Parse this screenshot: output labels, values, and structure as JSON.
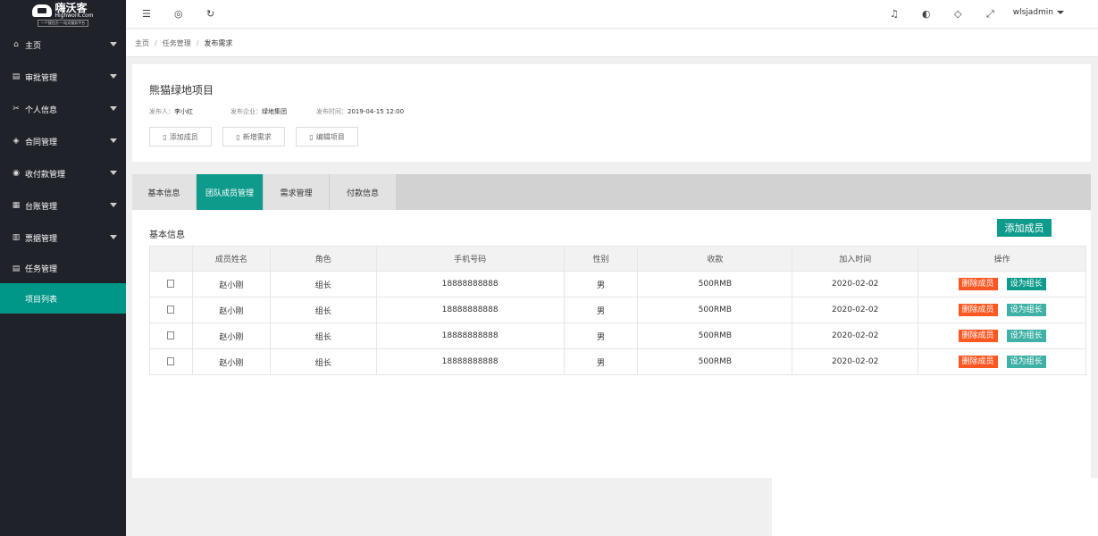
{
  "logo": {
    "name_cn": "嗨沃客",
    "name_en": "Highwork.com",
    "slogan": "一个接包方·一站式服务平台"
  },
  "sidebar": {
    "items": [
      {
        "label": "主页",
        "icon": "home-icon"
      },
      {
        "label": "审批管理",
        "icon": "approval-icon"
      },
      {
        "label": "个人信息",
        "icon": "user-info-icon"
      },
      {
        "label": "合同管理",
        "icon": "contract-icon"
      },
      {
        "label": "收付款管理",
        "icon": "payment-icon"
      },
      {
        "label": "台账管理",
        "icon": "ledger-icon"
      },
      {
        "label": "票据管理",
        "icon": "invoice-icon"
      },
      {
        "label": "任务管理",
        "icon": "task-icon"
      }
    ],
    "sub_item": "项目列表"
  },
  "header": {
    "user": "wlsjadmin"
  },
  "breadcrumb": {
    "home": "主页",
    "level1": "任务管理",
    "current": "发布需求"
  },
  "project": {
    "title": "熊猫绿地项目",
    "publisher_label": "发布人：",
    "publisher": "李小红",
    "company_label": "发布企业：",
    "company": "绿地集团",
    "time_label": "发布时间：",
    "time": "2019-04-15 12:00",
    "buttons": [
      "添加成员",
      "新增需求",
      "编辑项目"
    ]
  },
  "tabs": [
    "基本信息",
    "团队成员管理",
    "需求管理",
    "付款信息"
  ],
  "active_tab": "团队成员管理",
  "panel": {
    "title": "基本信息",
    "add_button": "添加成员",
    "columns": [
      "",
      "成员姓名",
      "角色",
      "手机号码",
      "性别",
      "收款",
      "加入时间",
      "操作"
    ],
    "rows": [
      {
        "name": "赵小刚",
        "role": "组长",
        "phone": "18888888888",
        "gender": "男",
        "amount": "500RMB",
        "joined": "2020-02-02"
      },
      {
        "name": "赵小刚",
        "role": "组长",
        "phone": "18888888888",
        "gender": "男",
        "amount": "500RMB",
        "joined": "2020-02-02"
      },
      {
        "name": "赵小刚",
        "role": "组长",
        "phone": "18888888888",
        "gender": "男",
        "amount": "500RMB",
        "joined": "2020-02-02"
      },
      {
        "name": "赵小刚",
        "role": "组长",
        "phone": "18888888888",
        "gender": "男",
        "amount": "500RMB",
        "joined": "2020-02-02"
      }
    ],
    "op_delete": "删除成员",
    "op_lead": "设为组长"
  },
  "colors": {
    "accent": "#009688",
    "danger": "#ff5722",
    "sidebar_bg": "#20222a"
  }
}
